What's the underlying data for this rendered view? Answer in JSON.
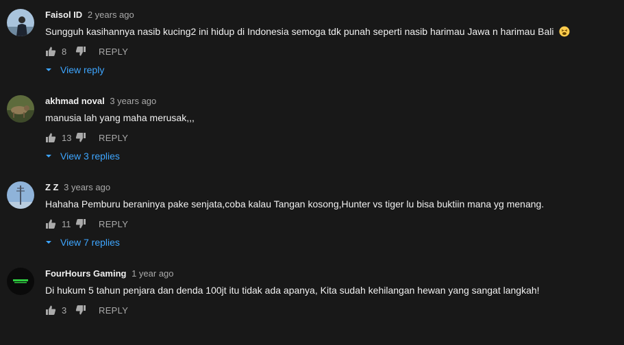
{
  "comments": [
    {
      "author": "Faisol ID",
      "time": "2 years ago",
      "text": "Sungguh kasihannya nasib kucing2 ini hidup di Indonesia semoga tdk punah seperti nasib harimau Jawa n harimau Bali",
      "emoji": "tired-face-emoji",
      "likes": "8",
      "reply_label": "REPLY",
      "view_replies": "View reply"
    },
    {
      "author": "akhmad noval",
      "time": "3 years ago",
      "text": "manusia lah yang maha merusak,,,",
      "likes": "13",
      "reply_label": "REPLY",
      "view_replies": "View 3 replies"
    },
    {
      "author": "Z Z",
      "time": "3 years ago",
      "text": "Hahaha Pemburu beraninya pake senjata,coba kalau Tangan kosong,Hunter vs tiger lu bisa buktiin mana yg menang.",
      "likes": "11",
      "reply_label": "REPLY",
      "view_replies": "View 7 replies"
    },
    {
      "author": "FourHours Gaming",
      "time": "1 year ago",
      "text": "Di hukum 5 tahun penjara dan denda 100jt itu tidak ada apanya,  Kita sudah kehilangan hewan yang sangat langkah!",
      "likes": "3",
      "reply_label": "REPLY"
    }
  ],
  "colors": {
    "background": "#181818",
    "text": "#f1f1f1",
    "secondary": "#aaaaaa",
    "link": "#3ea6ff"
  }
}
